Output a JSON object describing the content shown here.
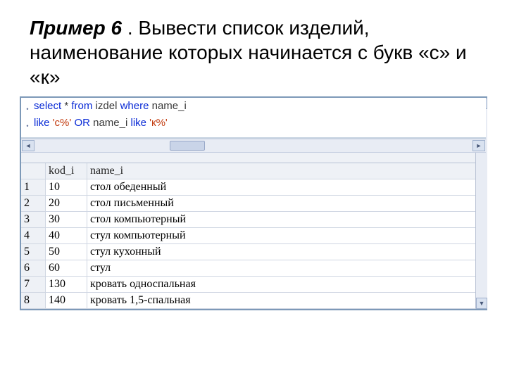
{
  "heading": {
    "label_bold": "Пример 6",
    "label_rest": " . Вывести список изделий, наименование которых начинается с букв «с» и «к»"
  },
  "sql": {
    "line1": {
      "kw_select": "select",
      "star": " * ",
      "kw_from": "from",
      "sp1": " ",
      "ident_table": "izdel",
      "sp2": " ",
      "kw_where": "where",
      "sp3": " ",
      "ident_col": "name_i"
    },
    "line2": {
      "kw_like1": "like",
      "sp1": " ",
      "str1": "'с%'",
      "sp2": " ",
      "kw_or": "OR",
      "sp3": " ",
      "ident_col": "name_i",
      "sp4": " ",
      "kw_like2": "like",
      "sp5": " ",
      "str2": "'к%'"
    }
  },
  "scroll": {
    "left_glyph": "◄",
    "right_glyph": "►",
    "up_glyph": "▲",
    "down_glyph": "▼"
  },
  "grid": {
    "headers": {
      "rownum": "",
      "kod_i": "kod_i",
      "name_i": "name_i"
    },
    "rows": [
      {
        "n": "1",
        "kod_i": "10",
        "name_i": "стол обеденный"
      },
      {
        "n": "2",
        "kod_i": "20",
        "name_i": "стол письменный"
      },
      {
        "n": "3",
        "kod_i": "30",
        "name_i": "стол компьютерный"
      },
      {
        "n": "4",
        "kod_i": "40",
        "name_i": "стул компьютерный"
      },
      {
        "n": "5",
        "kod_i": "50",
        "name_i": "стул кухонный"
      },
      {
        "n": "6",
        "kod_i": "60",
        "name_i": "стул"
      },
      {
        "n": "7",
        "kod_i": "130",
        "name_i": "кровать односпальная"
      },
      {
        "n": "8",
        "kod_i": "140",
        "name_i": "кровать 1,5-спальная"
      }
    ]
  }
}
